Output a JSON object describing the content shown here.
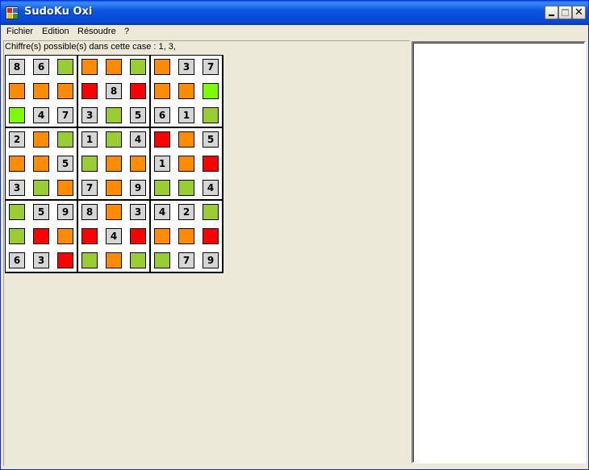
{
  "window": {
    "title": "SudoKu Oxi",
    "icon": "sudoku-app-icon",
    "minimize_label": "",
    "maximize_label": "",
    "close_label": "✕"
  },
  "menu": {
    "items": [
      "Fichier",
      "Edition",
      "Résoudre",
      "?"
    ]
  },
  "status": {
    "text": "Chiffre(s) possible(s) dans cette case : 1, 3,"
  },
  "colors": {
    "given": "#d6d6d6",
    "orange": "#ff8c00",
    "red": "#ff0000",
    "green": "#9acd32",
    "lime": "#7cfc00"
  },
  "grid": [
    [
      {
        "v": "8"
      },
      {
        "v": "6"
      },
      {
        "c": "green"
      },
      {
        "c": "orange"
      },
      {
        "c": "orange"
      },
      {
        "c": "green"
      },
      {
        "c": "orange"
      },
      {
        "v": "3"
      },
      {
        "v": "7"
      }
    ],
    [
      {
        "c": "orange"
      },
      {
        "c": "orange"
      },
      {
        "c": "orange"
      },
      {
        "c": "red"
      },
      {
        "v": "8"
      },
      {
        "c": "red"
      },
      {
        "c": "orange"
      },
      {
        "c": "orange"
      },
      {
        "c": "lime"
      }
    ],
    [
      {
        "c": "lime"
      },
      {
        "v": "4"
      },
      {
        "v": "7"
      },
      {
        "v": "3"
      },
      {
        "c": "green"
      },
      {
        "v": "5"
      },
      {
        "v": "6"
      },
      {
        "v": "1"
      },
      {
        "c": "green"
      }
    ],
    [
      {
        "v": "2"
      },
      {
        "c": "orange"
      },
      {
        "c": "green"
      },
      {
        "v": "1"
      },
      {
        "c": "green"
      },
      {
        "v": "4"
      },
      {
        "c": "red"
      },
      {
        "c": "orange"
      },
      {
        "v": "5"
      }
    ],
    [
      {
        "c": "orange"
      },
      {
        "c": "orange"
      },
      {
        "v": "5"
      },
      {
        "c": "green"
      },
      {
        "c": "orange"
      },
      {
        "c": "orange"
      },
      {
        "v": "1"
      },
      {
        "c": "orange"
      },
      {
        "c": "red"
      }
    ],
    [
      {
        "v": "3"
      },
      {
        "c": "green"
      },
      {
        "c": "orange"
      },
      {
        "v": "7"
      },
      {
        "c": "orange"
      },
      {
        "v": "9"
      },
      {
        "c": "green"
      },
      {
        "c": "green"
      },
      {
        "v": "4"
      }
    ],
    [
      {
        "c": "green"
      },
      {
        "v": "5"
      },
      {
        "v": "9"
      },
      {
        "v": "8"
      },
      {
        "c": "orange"
      },
      {
        "v": "3"
      },
      {
        "v": "4"
      },
      {
        "v": "2"
      },
      {
        "c": "green"
      }
    ],
    [
      {
        "c": "green"
      },
      {
        "c": "red"
      },
      {
        "c": "orange"
      },
      {
        "c": "red"
      },
      {
        "v": "4"
      },
      {
        "c": "red"
      },
      {
        "c": "orange"
      },
      {
        "c": "orange"
      },
      {
        "c": "red"
      }
    ],
    [
      {
        "v": "6"
      },
      {
        "v": "3"
      },
      {
        "c": "red"
      },
      {
        "c": "green"
      },
      {
        "c": "orange"
      },
      {
        "c": "green"
      },
      {
        "c": "green"
      },
      {
        "v": "7"
      },
      {
        "v": "9"
      }
    ]
  ]
}
